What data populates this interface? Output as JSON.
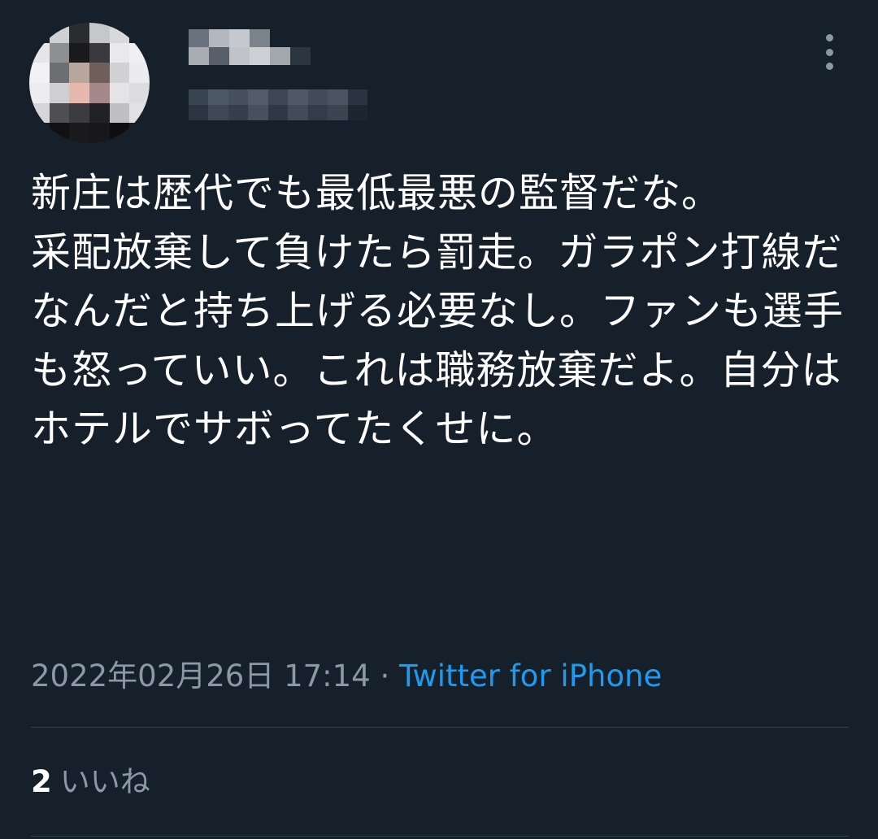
{
  "tweet": {
    "text": "新庄は歴代でも最低最悪の監督だな。\n采配放棄して負けたら罰走。ガラポン打線だなんだと持ち上げる必要なし。ファンも選手も怒っていい。これは職務放棄だよ。自分はホテルでサボってたくせに。",
    "timestamp": "2022年02月26日 17:14",
    "separator": " · ",
    "source": "Twitter for iPhone",
    "likes_count": "2",
    "likes_label": "いいね"
  },
  "icons": {
    "more": "more-vertical-icon"
  },
  "colors": {
    "background": "#15202b",
    "text": "#ffffff",
    "secondary": "#8b98a5",
    "link": "#1d9bf0",
    "divider": "#38444d"
  }
}
